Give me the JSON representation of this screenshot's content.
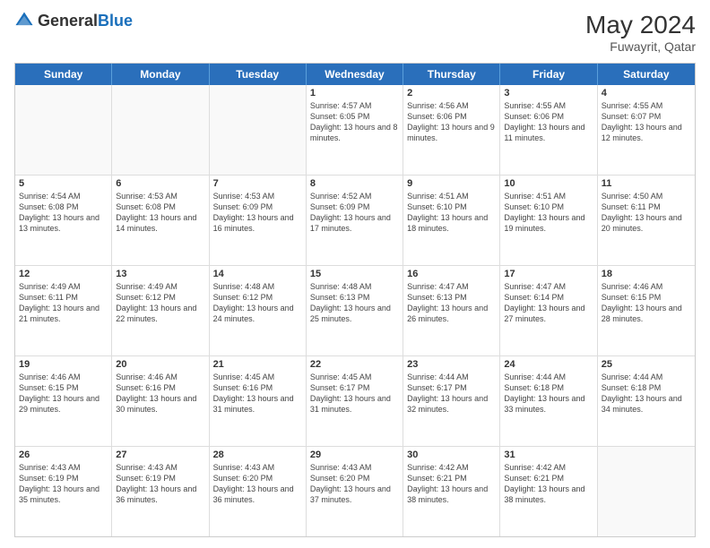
{
  "header": {
    "logo_general": "General",
    "logo_blue": "Blue",
    "month_year": "May 2024",
    "location": "Fuwayrit, Qatar"
  },
  "days_of_week": [
    "Sunday",
    "Monday",
    "Tuesday",
    "Wednesday",
    "Thursday",
    "Friday",
    "Saturday"
  ],
  "weeks": [
    [
      {
        "day": "",
        "info": ""
      },
      {
        "day": "",
        "info": ""
      },
      {
        "day": "",
        "info": ""
      },
      {
        "day": "1",
        "info": "Sunrise: 4:57 AM\nSunset: 6:05 PM\nDaylight: 13 hours\nand 8 minutes."
      },
      {
        "day": "2",
        "info": "Sunrise: 4:56 AM\nSunset: 6:06 PM\nDaylight: 13 hours\nand 9 minutes."
      },
      {
        "day": "3",
        "info": "Sunrise: 4:55 AM\nSunset: 6:06 PM\nDaylight: 13 hours\nand 11 minutes."
      },
      {
        "day": "4",
        "info": "Sunrise: 4:55 AM\nSunset: 6:07 PM\nDaylight: 13 hours\nand 12 minutes."
      }
    ],
    [
      {
        "day": "5",
        "info": "Sunrise: 4:54 AM\nSunset: 6:08 PM\nDaylight: 13 hours\nand 13 minutes."
      },
      {
        "day": "6",
        "info": "Sunrise: 4:53 AM\nSunset: 6:08 PM\nDaylight: 13 hours\nand 14 minutes."
      },
      {
        "day": "7",
        "info": "Sunrise: 4:53 AM\nSunset: 6:09 PM\nDaylight: 13 hours\nand 16 minutes."
      },
      {
        "day": "8",
        "info": "Sunrise: 4:52 AM\nSunset: 6:09 PM\nDaylight: 13 hours\nand 17 minutes."
      },
      {
        "day": "9",
        "info": "Sunrise: 4:51 AM\nSunset: 6:10 PM\nDaylight: 13 hours\nand 18 minutes."
      },
      {
        "day": "10",
        "info": "Sunrise: 4:51 AM\nSunset: 6:10 PM\nDaylight: 13 hours\nand 19 minutes."
      },
      {
        "day": "11",
        "info": "Sunrise: 4:50 AM\nSunset: 6:11 PM\nDaylight: 13 hours\nand 20 minutes."
      }
    ],
    [
      {
        "day": "12",
        "info": "Sunrise: 4:49 AM\nSunset: 6:11 PM\nDaylight: 13 hours\nand 21 minutes."
      },
      {
        "day": "13",
        "info": "Sunrise: 4:49 AM\nSunset: 6:12 PM\nDaylight: 13 hours\nand 22 minutes."
      },
      {
        "day": "14",
        "info": "Sunrise: 4:48 AM\nSunset: 6:12 PM\nDaylight: 13 hours\nand 24 minutes."
      },
      {
        "day": "15",
        "info": "Sunrise: 4:48 AM\nSunset: 6:13 PM\nDaylight: 13 hours\nand 25 minutes."
      },
      {
        "day": "16",
        "info": "Sunrise: 4:47 AM\nSunset: 6:13 PM\nDaylight: 13 hours\nand 26 minutes."
      },
      {
        "day": "17",
        "info": "Sunrise: 4:47 AM\nSunset: 6:14 PM\nDaylight: 13 hours\nand 27 minutes."
      },
      {
        "day": "18",
        "info": "Sunrise: 4:46 AM\nSunset: 6:15 PM\nDaylight: 13 hours\nand 28 minutes."
      }
    ],
    [
      {
        "day": "19",
        "info": "Sunrise: 4:46 AM\nSunset: 6:15 PM\nDaylight: 13 hours\nand 29 minutes."
      },
      {
        "day": "20",
        "info": "Sunrise: 4:46 AM\nSunset: 6:16 PM\nDaylight: 13 hours\nand 30 minutes."
      },
      {
        "day": "21",
        "info": "Sunrise: 4:45 AM\nSunset: 6:16 PM\nDaylight: 13 hours\nand 31 minutes."
      },
      {
        "day": "22",
        "info": "Sunrise: 4:45 AM\nSunset: 6:17 PM\nDaylight: 13 hours\nand 31 minutes."
      },
      {
        "day": "23",
        "info": "Sunrise: 4:44 AM\nSunset: 6:17 PM\nDaylight: 13 hours\nand 32 minutes."
      },
      {
        "day": "24",
        "info": "Sunrise: 4:44 AM\nSunset: 6:18 PM\nDaylight: 13 hours\nand 33 minutes."
      },
      {
        "day": "25",
        "info": "Sunrise: 4:44 AM\nSunset: 6:18 PM\nDaylight: 13 hours\nand 34 minutes."
      }
    ],
    [
      {
        "day": "26",
        "info": "Sunrise: 4:43 AM\nSunset: 6:19 PM\nDaylight: 13 hours\nand 35 minutes."
      },
      {
        "day": "27",
        "info": "Sunrise: 4:43 AM\nSunset: 6:19 PM\nDaylight: 13 hours\nand 36 minutes."
      },
      {
        "day": "28",
        "info": "Sunrise: 4:43 AM\nSunset: 6:20 PM\nDaylight: 13 hours\nand 36 minutes."
      },
      {
        "day": "29",
        "info": "Sunrise: 4:43 AM\nSunset: 6:20 PM\nDaylight: 13 hours\nand 37 minutes."
      },
      {
        "day": "30",
        "info": "Sunrise: 4:42 AM\nSunset: 6:21 PM\nDaylight: 13 hours\nand 38 minutes."
      },
      {
        "day": "31",
        "info": "Sunrise: 4:42 AM\nSunset: 6:21 PM\nDaylight: 13 hours\nand 38 minutes."
      },
      {
        "day": "",
        "info": ""
      }
    ]
  ]
}
